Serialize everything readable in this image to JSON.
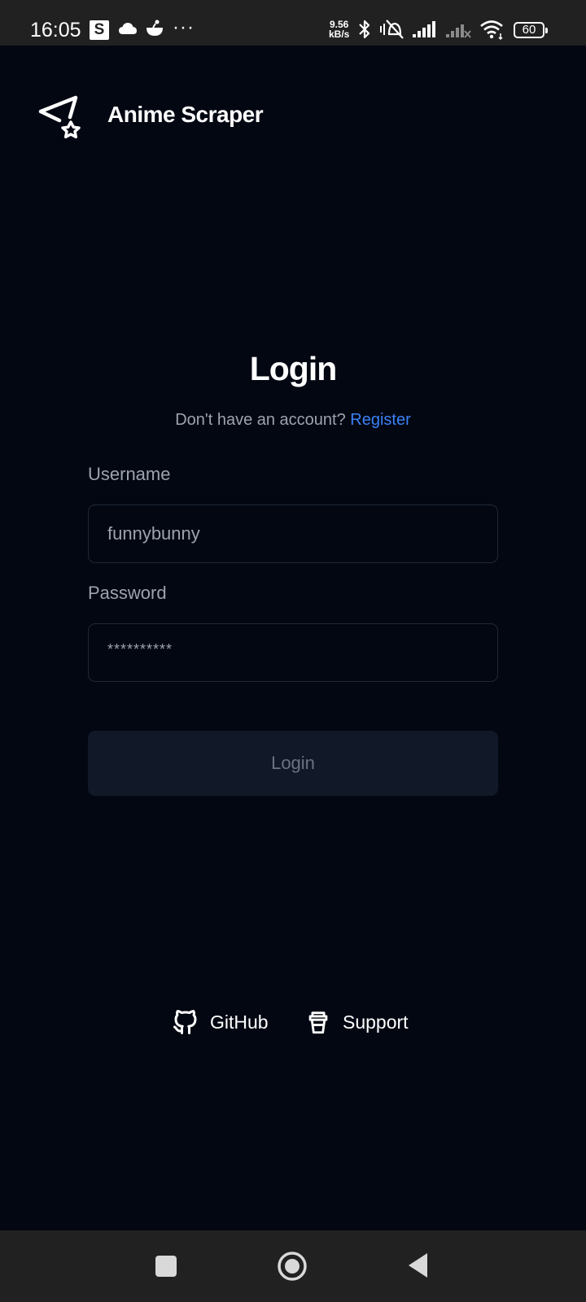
{
  "status_bar": {
    "time": "16:05",
    "notification_badge": "S",
    "speed_value": "9.56",
    "speed_unit": "kB/s",
    "battery": "60",
    "icons": [
      "cloud-icon",
      "bowl-icon",
      "more-dots-icon",
      "bluetooth-icon",
      "vibrate-off-icon",
      "signal-icon",
      "signal-weak-icon",
      "wifi-icon",
      "battery-icon"
    ]
  },
  "header": {
    "app_name": "Anime Scraper",
    "logo_icon": "paper-plane-star-icon"
  },
  "login": {
    "heading": "Login",
    "no_account_text": "Don't have an account?",
    "register_link": "Register",
    "username_label": "Username",
    "username_value": "funnybunny",
    "password_label": "Password",
    "password_value": "**********",
    "submit_label": "Login"
  },
  "footer": {
    "github_label": "GitHub",
    "support_label": "Support"
  },
  "colors": {
    "background": "#030712",
    "link": "#3b82f6",
    "muted_text": "#9ca3af",
    "button_bg": "#111827",
    "status_bar": "#212121"
  }
}
